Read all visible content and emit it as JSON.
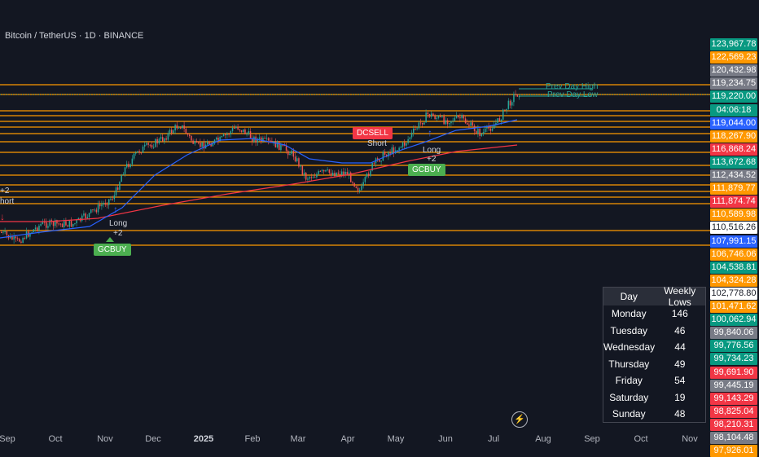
{
  "title": "Bitcoin / TetherUS · 1D · BINANCE",
  "x_axis_labels": [
    {
      "text": "Sep",
      "bold": false
    },
    {
      "text": "Oct",
      "bold": false
    },
    {
      "text": "Nov",
      "bold": false
    },
    {
      "text": "Dec",
      "bold": false
    },
    {
      "text": "2025",
      "bold": true
    },
    {
      "text": "Feb",
      "bold": false
    },
    {
      "text": "Mar",
      "bold": false
    },
    {
      "text": "Apr",
      "bold": false
    },
    {
      "text": "May",
      "bold": false
    },
    {
      "text": "Jun",
      "bold": false
    },
    {
      "text": "Jul",
      "bold": false
    },
    {
      "text": "Aug",
      "bold": false
    },
    {
      "text": "Sep",
      "bold": false
    },
    {
      "text": "Oct",
      "bold": false
    },
    {
      "text": "Nov",
      "bold": false
    }
  ],
  "price_tags": [
    {
      "text": "123,967.78",
      "color": "#089981"
    },
    {
      "text": "122,569.23",
      "color": "#ff9800"
    },
    {
      "text": "120,432.98",
      "color": "#787b86"
    },
    {
      "text": "119,234.75",
      "color": "#787b86"
    },
    {
      "text": "119,220.00",
      "color": "#089981"
    },
    {
      "text": "04:06:18",
      "color": "#089981"
    },
    {
      "text": "119,044.00",
      "color": "#2962ff"
    },
    {
      "text": "118,267.90",
      "color": "#ff9800"
    },
    {
      "text": "116,868.24",
      "color": "#f23645"
    },
    {
      "text": "113,672.68",
      "color": "#089981"
    },
    {
      "text": "112,434.52",
      "color": "#787b86"
    },
    {
      "text": "111,879.77",
      "color": "#ff9800"
    },
    {
      "text": "111,874.74",
      "color": "#f23645"
    },
    {
      "text": "110,589.98",
      "color": "#ff9800"
    },
    {
      "text": "110,516.26",
      "color": "#ffffff"
    },
    {
      "text": "107,991.15",
      "color": "#2962ff"
    },
    {
      "text": "106,746.06",
      "color": "#ff9800"
    },
    {
      "text": "104,538.81",
      "color": "#089981"
    },
    {
      "text": "104,324.28",
      "color": "#ff9800"
    },
    {
      "text": "102,778.80",
      "color": "#ffffff"
    },
    {
      "text": "101,471.62",
      "color": "#ff9800"
    },
    {
      "text": "100,062.94",
      "color": "#089981"
    },
    {
      "text": "99,840.06",
      "color": "#787b86"
    },
    {
      "text": "99,776.56",
      "color": "#089981"
    },
    {
      "text": "99,734.23",
      "color": "#089981"
    },
    {
      "text": "99,691.90",
      "color": "#f23645"
    },
    {
      "text": "99,445.19",
      "color": "#787b86"
    },
    {
      "text": "99,143.29",
      "color": "#f23645"
    },
    {
      "text": "98,825.04",
      "color": "#f23645"
    },
    {
      "text": "98,210.31",
      "color": "#f23645"
    },
    {
      "text": "98,104.48",
      "color": "#787b86"
    },
    {
      "text": "97,926.01",
      "color": "#ff9800"
    }
  ],
  "weekly_lows_table": {
    "headers": [
      "Day",
      "Weekly Lows"
    ],
    "rows": [
      {
        "day": "Monday",
        "value": "146"
      },
      {
        "day": "Tuesday",
        "value": "46"
      },
      {
        "day": "Wednesday",
        "value": "44"
      },
      {
        "day": "Thursday",
        "value": "49"
      },
      {
        "day": "Friday",
        "value": "54"
      },
      {
        "day": "Saturday",
        "value": "19"
      },
      {
        "day": "Sunday",
        "value": "48"
      }
    ]
  },
  "annotations": {
    "prev_day_high": "Prev Day High",
    "prev_day_low": "Prev Day Low",
    "gcbuy_1": "GCBUY",
    "gcbuy_2": "GCBUY",
    "long_1": "Long",
    "long_1_val": "+2",
    "long_2": "Long",
    "long_2_val": "+2",
    "short_left": "hort",
    "short_left_val": "+2",
    "short_mid": "Short",
    "dcsell": "DCSELL"
  },
  "colors": {
    "background": "#131722",
    "up": "#26a69a",
    "down": "#ef5350",
    "level": "#ff9800",
    "ma_blue": "#2962ff",
    "ma_red": "#f23645"
  },
  "icons": {
    "replay": "lightning-icon"
  }
}
